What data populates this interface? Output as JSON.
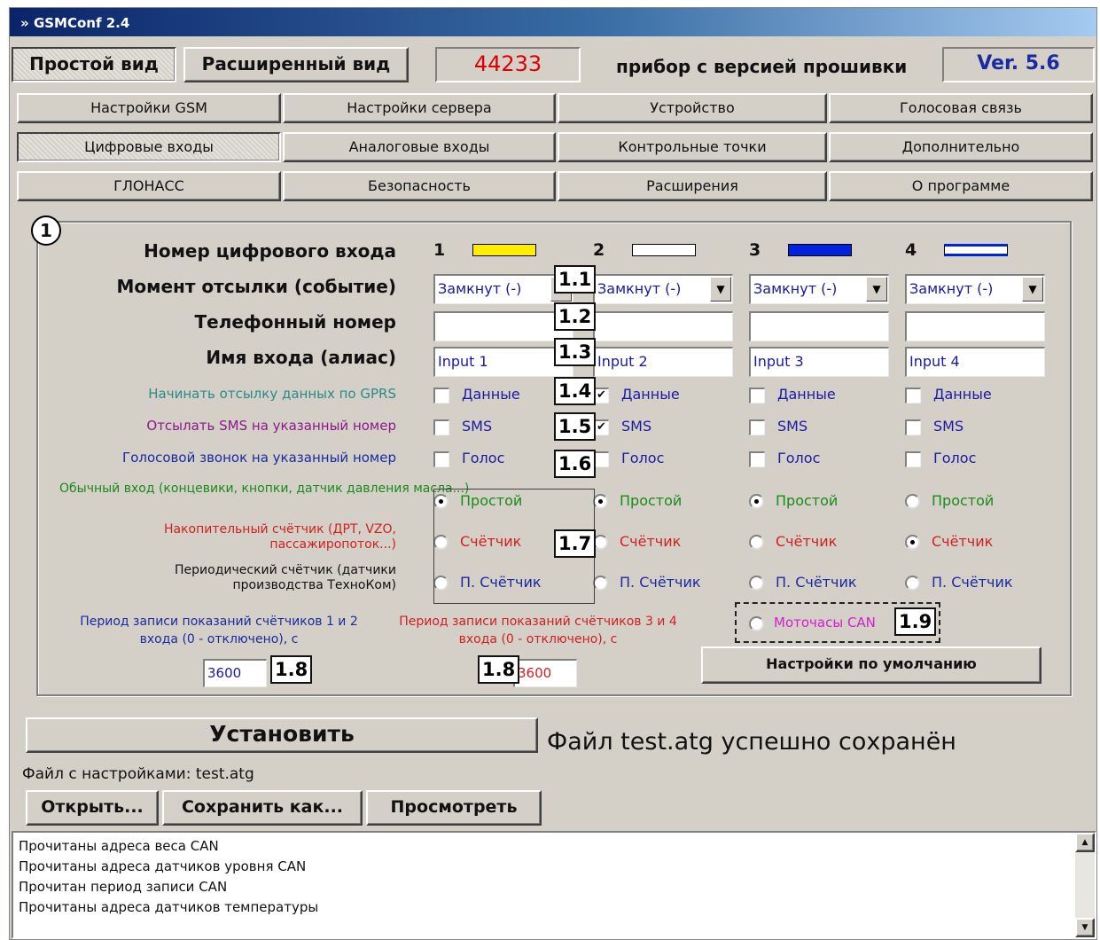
{
  "window": {
    "title": "GSMConf 2.4"
  },
  "top_bar": {
    "simple_view": "Простой вид",
    "extended_view": "Расширенный вид",
    "device_code": "44233",
    "firmware_label": "прибор с версией прошивки",
    "version": "Ver. 5.6"
  },
  "tabs": [
    "Настройки GSM",
    "Настройки сервера",
    "Устройство",
    "Голосовая связь",
    "Цифровые входы",
    "Аналоговые входы",
    "Контрольные точки",
    "Дополнительно",
    "ГЛОНАСС",
    "Безопасность",
    "Расширения",
    "О программе"
  ],
  "active_tab": "Цифровые входы",
  "panel": {
    "number_badge": "1",
    "row_labels": {
      "input_number": "Номер цифрового входа",
      "send_moment": "Момент отсылки (событие)",
      "phone": "Телефонный номер",
      "alias": "Имя входа (алиас)",
      "gprs": "Начинать отсылку данных по GPRS",
      "sms": "Отсылать SMS на указанный номер",
      "voice": "Голосовой звонок на указанный номер",
      "simple_desc": "Обычный вход (концевики, кнопки, датчик давления масла...)",
      "counter_desc": "Накопительный счётчик (ДРТ, VZO, пассажиропоток...)",
      "pcounter_desc": "Периодический счётчик (датчики производства ТехноКом)"
    },
    "inputs": [
      {
        "number": "1",
        "color": "#ffee00",
        "event": "Замкнут (-)",
        "phone": "",
        "alias": "Input 1",
        "gprs": false,
        "sms": false,
        "voice": false,
        "mode": "simple"
      },
      {
        "number": "2",
        "color": "#ffffff",
        "event": "Замкнут (-)",
        "phone": "",
        "alias": "Input 2",
        "gprs": true,
        "sms": true,
        "voice": false,
        "mode": "simple"
      },
      {
        "number": "3",
        "color": "#0022dd",
        "event": "Замкнут (-)",
        "phone": "",
        "alias": "Input 3",
        "gprs": false,
        "sms": false,
        "voice": false,
        "mode": "simple"
      },
      {
        "number": "4",
        "color": "#0022dd",
        "event": "Замкнут (-)",
        "phone": "",
        "alias": "Input 4",
        "gprs": false,
        "sms": false,
        "voice": false,
        "mode": "counter"
      }
    ],
    "checkbox_labels": {
      "gprs": "Данные",
      "sms": "SMS",
      "voice": "Голос"
    },
    "radio_labels": {
      "simple": "Простой",
      "counter": "Счётчик",
      "pcounter": "П. Счётчик"
    },
    "period_12_label": "Период записи показаний счётчиков 1 и 2 входа (0 - отключено), с",
    "period_12_value": "3600",
    "period_34_label": "Период записи показаний счётчиков 3 и 4 входа (0 - отключено), с",
    "period_34_value": "3600",
    "motochasy_label": "Моточасы CAN",
    "defaults_button": "Настройки по умолчанию",
    "annotations": [
      "1.1",
      "1.2",
      "1.3",
      "1.4",
      "1.5",
      "1.6",
      "1.7",
      "1.8",
      "1.8",
      "1.9"
    ]
  },
  "bottom": {
    "install_button": "Установить",
    "status": "Файл test.atg успешно сохранён",
    "settings_file": "Файл с настройками: test.atg",
    "open_button": "Открыть...",
    "save_as_button": "Сохранить как...",
    "view_button": "Просмотреть",
    "log": [
      "Прочитаны адреса веса CAN",
      "Прочитаны адреса датчиков уровня CAN",
      "Прочитан период записи CAN",
      "Прочитаны адреса датчиков температуры"
    ]
  }
}
